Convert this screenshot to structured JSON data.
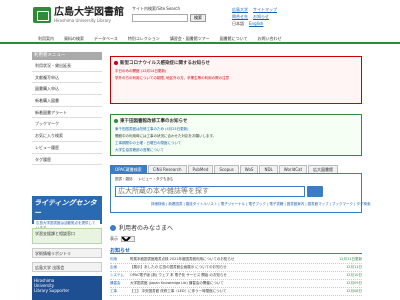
{
  "header": {
    "title_ja": "広島大学図書館",
    "title_en": "Hiroshima University Library",
    "search_label": "サイト内検索/Site Search",
    "search_button": "検索",
    "links_row1": [
      "広島大学",
      "サイトマップ"
    ],
    "links_row2": [
      "問合せ先",
      "お知らせ"
    ],
    "lang_ja": "日本語",
    "lang_en": "English"
  },
  "nav": [
    "利用案内",
    "資料の検索",
    "データベース",
    "特別コレクション",
    "講習会・図書館ツアー",
    "図書館について",
    "お問い合わせ"
  ],
  "sidebar": {
    "head": "利用者メニュー",
    "items": [
      "利用状況・貸出延長",
      "文献複写申込",
      "図書購入申込",
      "新着購入図書",
      "新着図書アラート",
      "ブックマーク",
      "お気に入り検索",
      "レビュー履歴",
      "タグ履歴"
    ]
  },
  "banners": {
    "lighting_title": "ライティングセンター",
    "lighting_sub": "広島大学図書館は活動拠点を提供しています。",
    "b2": "学習支援課と相談窓口",
    "b3": "学術情報リポジトリ",
    "b4": "広島大学 出版会",
    "b5_line1": "Hiroshima",
    "b5_line2": "University",
    "b5_line3": "Library Supporter"
  },
  "notice_red": {
    "title": "新型コロナウイルス感染症に関するお知らせ",
    "lines": [
      "平日のみの開館 (12月14日更新)",
      "学外の方の利用についての制限, 地区外の方、卒業生等の利用の際の注意"
    ]
  },
  "notice_green": {
    "title": "東千田図書館改修工事のお知らせ",
    "lines": [
      "東千田図書館は改修工事のため (4月25日更新)",
      "開館中の利用時には工事の状況に合わせた対応をお願いします。",
      "工事期間中の土曜・日曜日の閉館について",
      "大学生協書籍部の営業について"
    ]
  },
  "tabs": [
    "OPAC蔵書検索",
    "CiNii Research",
    "PubMed",
    "Scopus",
    "WoS",
    "NDL",
    "WorldCat",
    "広大図書館"
  ],
  "search": {
    "radio1": "図書・雑誌",
    "radio2": "レビュー・タグも含む",
    "placeholder": "広大所蔵の本や雑誌等を探す",
    "links": "詳細検索 | 新着図書 | 雑誌タイトルリスト | 電子ジャーナル | 電子ブック | 電子書籍 | 図書館案内 | 図書館マップ | ブックマーク | タグ検索"
  },
  "welcome": "利用者のみなさまへ",
  "display": {
    "label": "表示",
    "value": "5件"
  },
  "news_head": "お知らせ",
  "news": [
    {
      "cat": "利用",
      "text": "附属本館図書館蔵書点検 2021年度図書館利用についてのお知らせ",
      "date": "12月11日更新"
    },
    {
      "cat": "企画",
      "text": "【展示】あしたの 広島の図書館企画展示 についてのお知らせ",
      "date": "12月11日"
    },
    {
      "cat": "システム",
      "text": "OPAC電子版 (新) ウェブ 本 電子化 サービス 開始 のお知らせ",
      "date": "12月10日"
    },
    {
      "cat": "講習会",
      "text": "大学図書館 (Japan Knowledge Lib) 講習会の開催について",
      "date": "12月09日"
    },
    {
      "cat": "工事",
      "text": "【工】 中央図書館 改修工事（LED）に伴う一時閉館について",
      "date": "12月08日"
    }
  ],
  "colors": {
    "brand": "#2e8b3a",
    "accent": "#3b7dc4",
    "alert": "#cc0000"
  }
}
